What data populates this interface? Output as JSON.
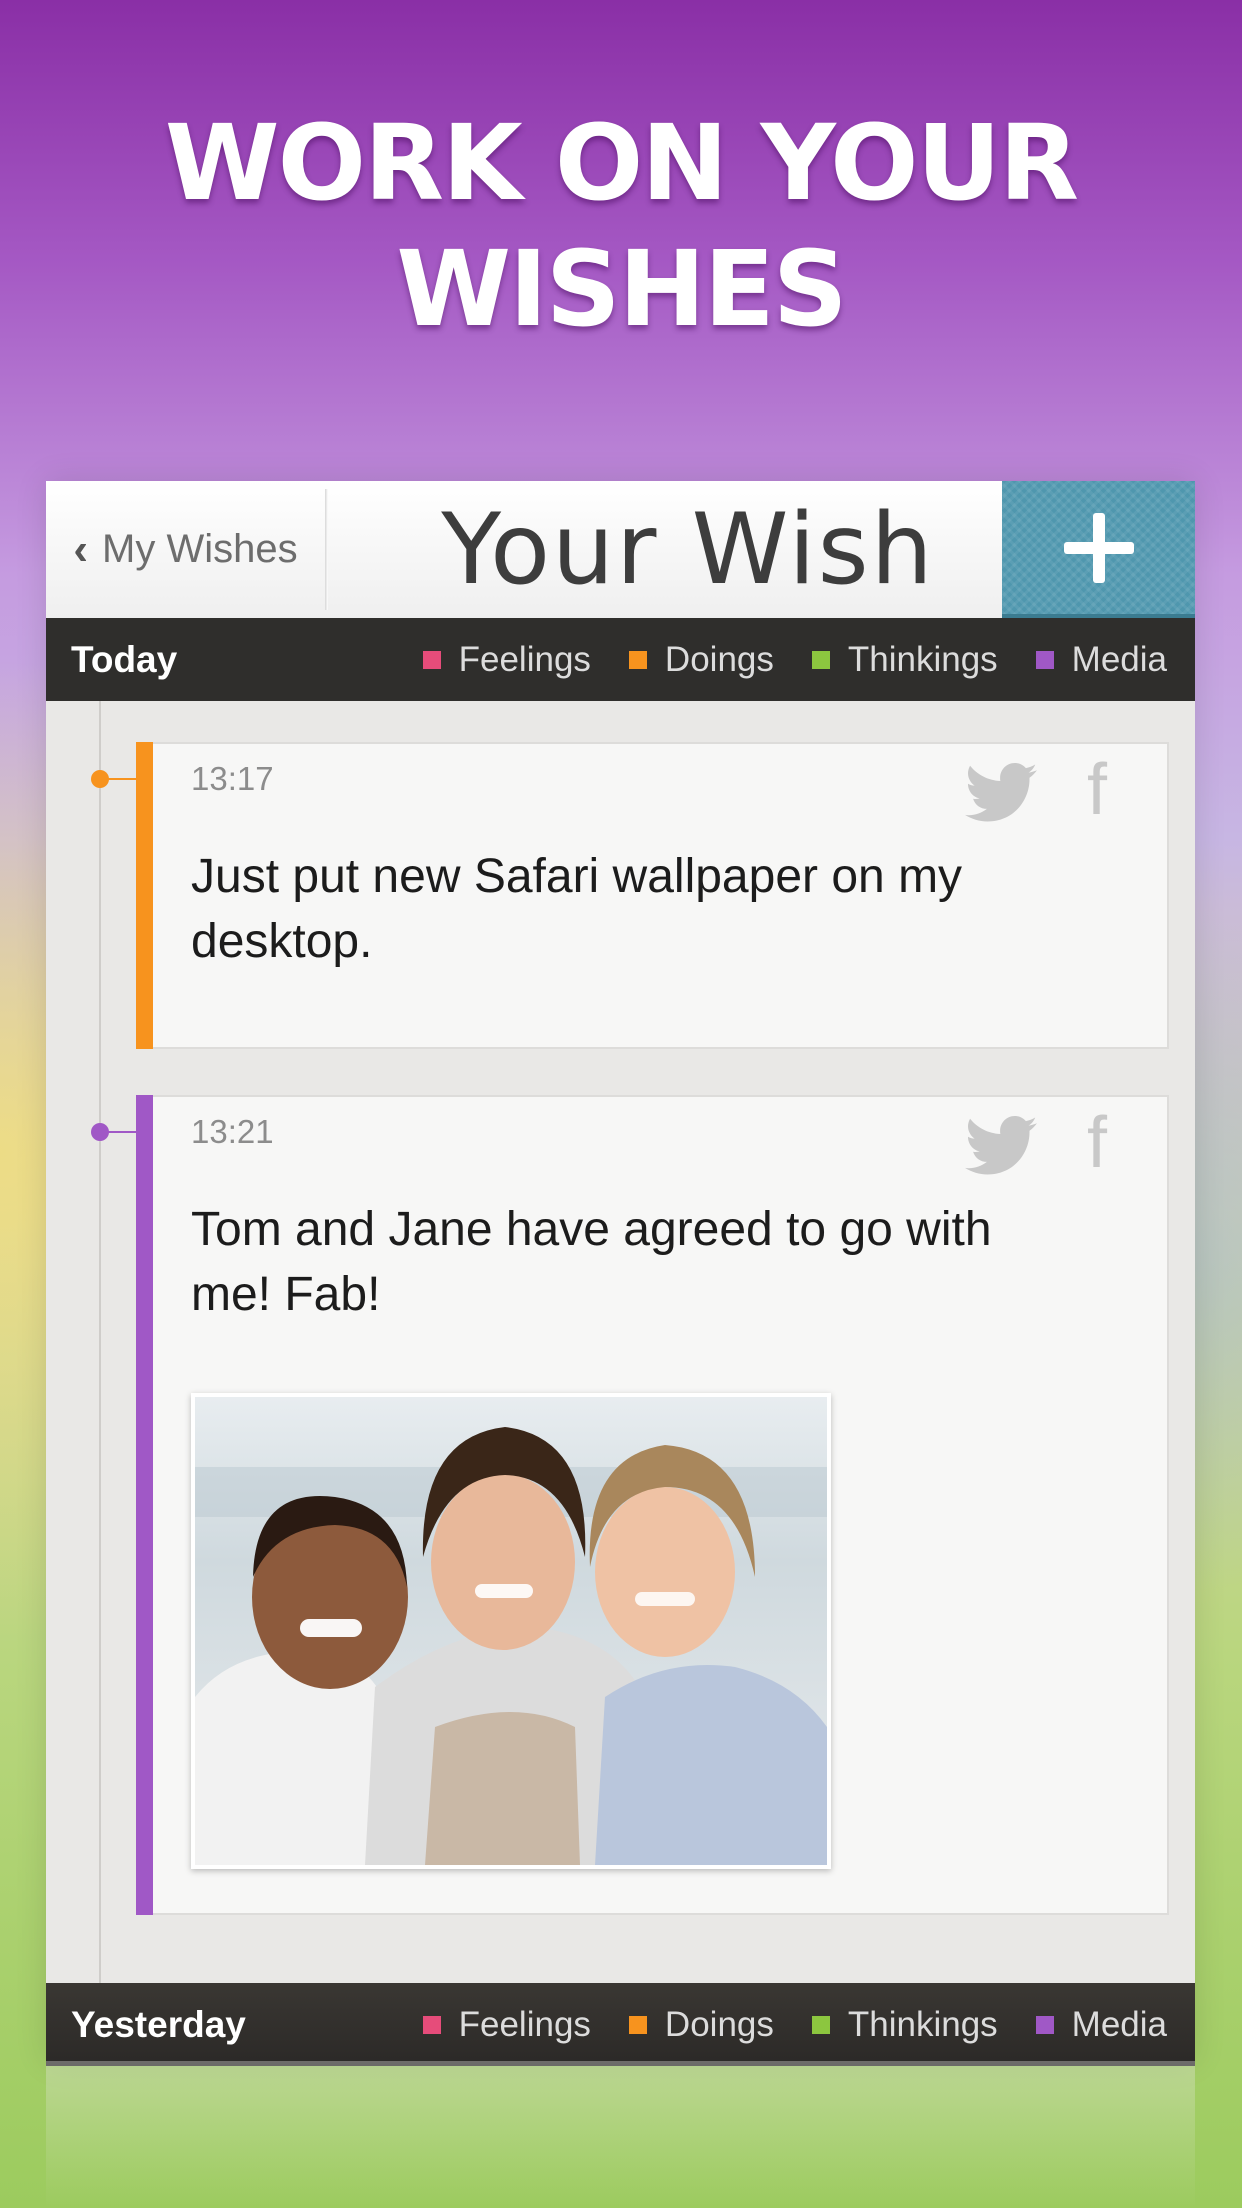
{
  "headline": {
    "line1": "WORK ON YOUR",
    "line2": "WISHES"
  },
  "navbar": {
    "back_label": "My Wishes",
    "title": "Your Wish",
    "add_icon": "plus-icon"
  },
  "legend": [
    {
      "label": "Feelings",
      "color": "#e64c7a"
    },
    {
      "label": "Doings",
      "color": "#f7931e"
    },
    {
      "label": "Thinkings",
      "color": "#8cc63f"
    },
    {
      "label": "Media",
      "color": "#a058c6"
    }
  ],
  "sections": {
    "today": "Today",
    "yesterday": "Yesterday"
  },
  "entries": [
    {
      "time": "13:17",
      "text": "Just put new Safari wallpaper on my desktop.",
      "category": "Doings",
      "color": "#f7931e"
    },
    {
      "time": "13:21",
      "text": "Tom and Jane have agreed to go with me! Fab!",
      "category": "Media",
      "color": "#a058c6",
      "has_photo": true
    }
  ]
}
